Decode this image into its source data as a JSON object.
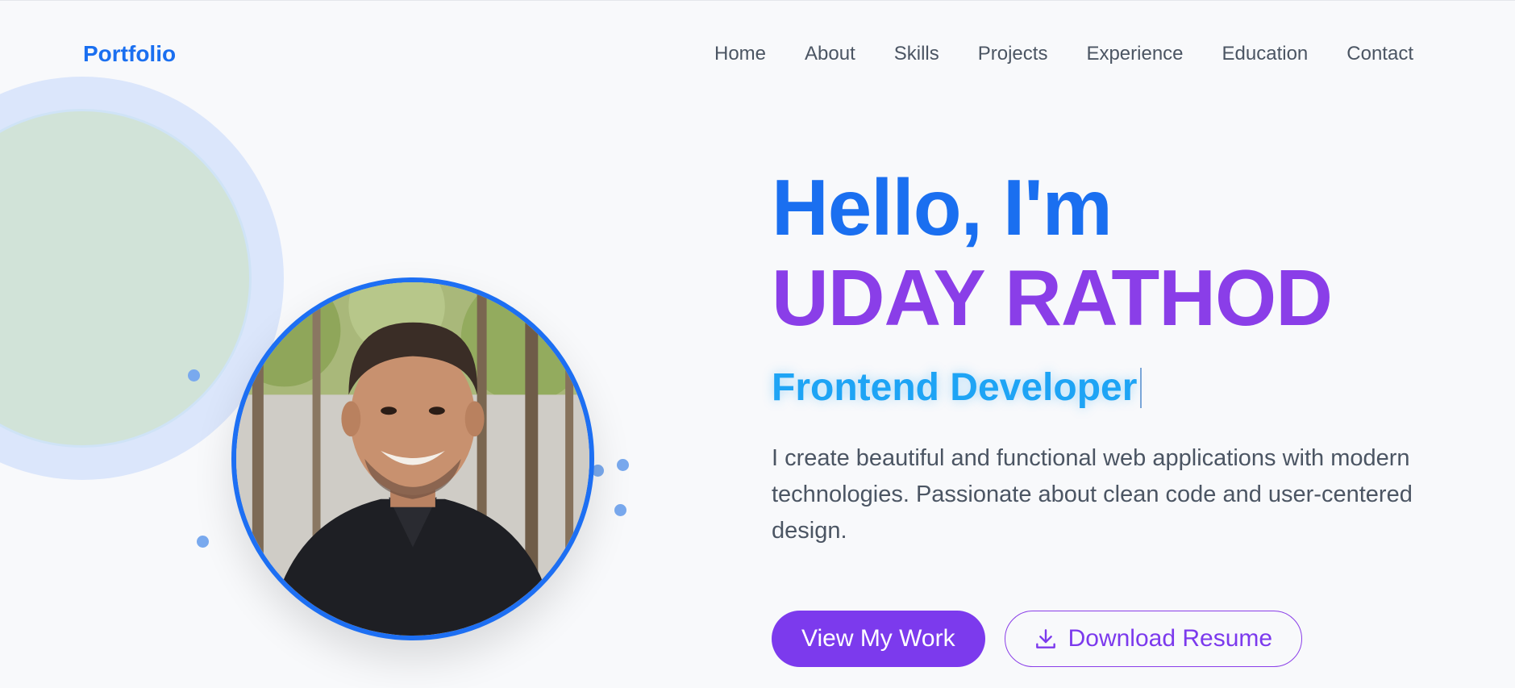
{
  "nav": {
    "logo": "Portfolio",
    "items": [
      "Home",
      "About",
      "Skills",
      "Projects",
      "Experience",
      "Education",
      "Contact"
    ]
  },
  "hero": {
    "greeting": "Hello, I'm",
    "name": "UDAY RATHOD",
    "role": "Frontend Developer",
    "description": "I create beautiful and functional web applications with modern technologies. Passionate about clean code and user-centered design.",
    "primary_button": "View My Work",
    "secondary_button": "Download Resume"
  },
  "icons": {
    "download": "download-icon"
  },
  "colors": {
    "brand_blue": "#1a6ff0",
    "accent_purple": "#7c3aed",
    "role_cyan": "#1ea4f5"
  }
}
